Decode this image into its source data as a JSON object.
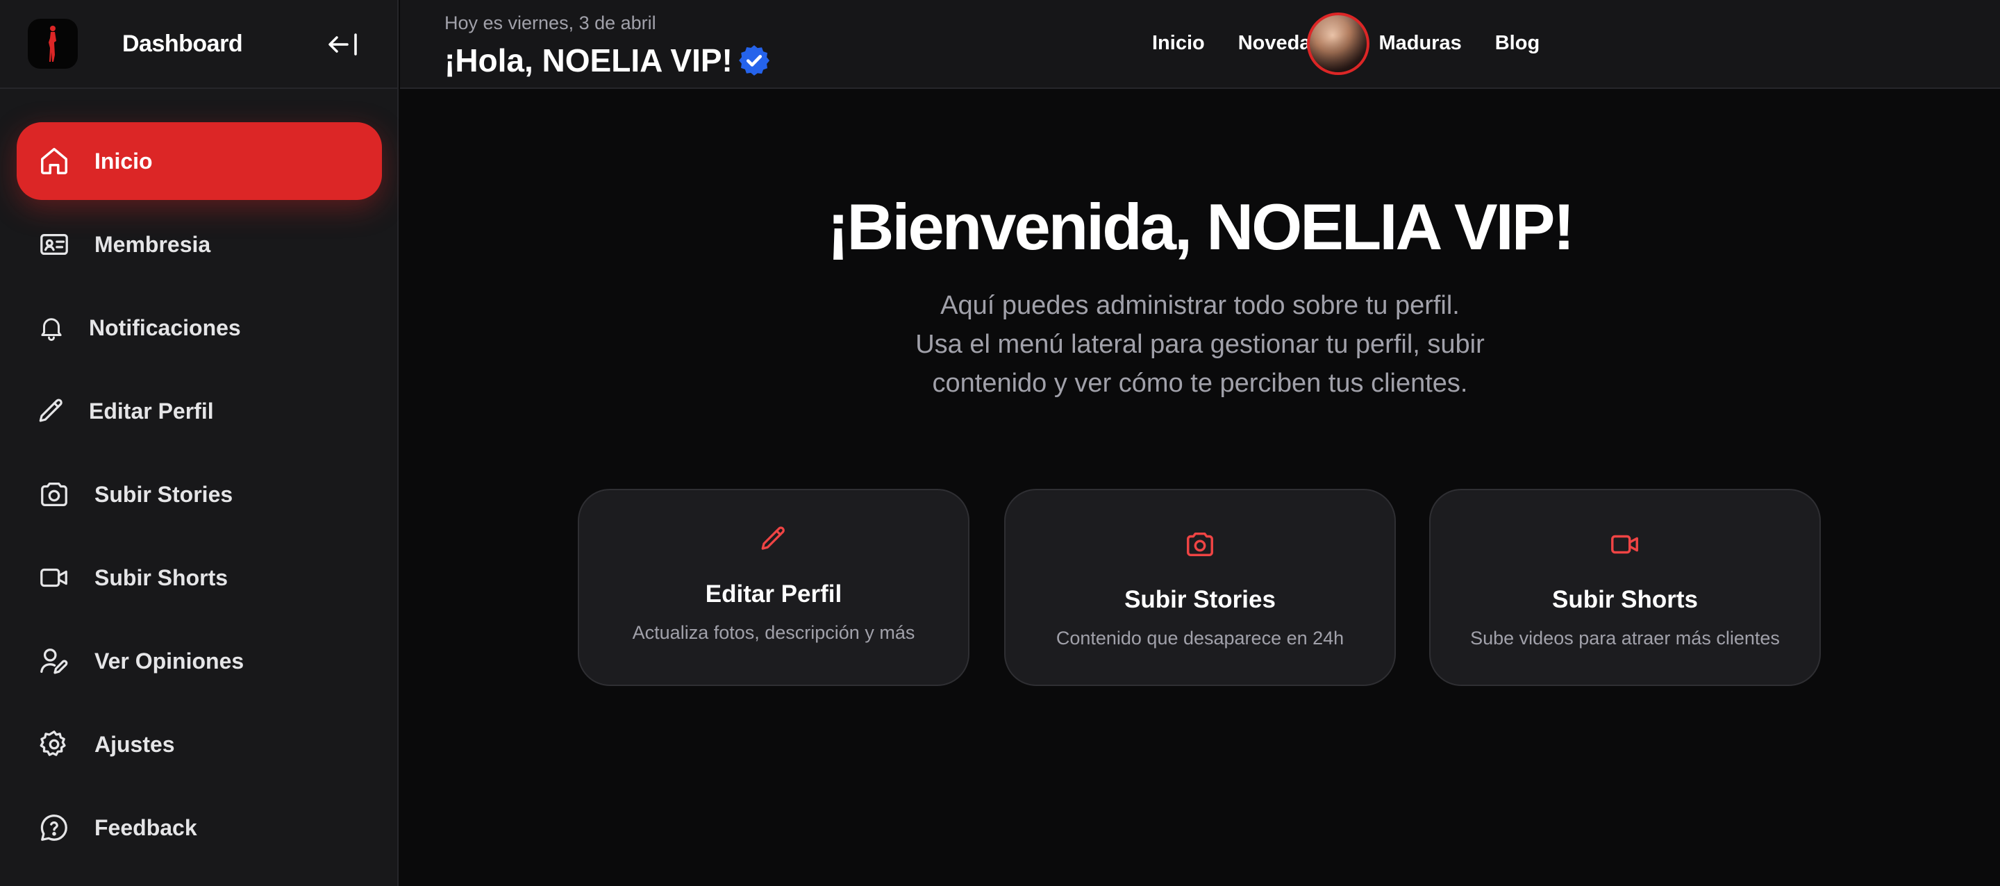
{
  "colors": {
    "accent": "#dc2626",
    "verified": "#2563eb",
    "background": "#0a0a0b",
    "sidebar": "#18181a"
  },
  "brand": {
    "title": "Dashboard",
    "logo_icon": "silhouette-logo-icon"
  },
  "sidebar": {
    "collapse_icon": "arrow-left-bar-icon",
    "items": [
      {
        "label": "Inicio",
        "icon": "home-icon",
        "active": true
      },
      {
        "label": "Membresia",
        "icon": "id-card-icon",
        "active": false
      },
      {
        "label": "Notificaciones",
        "icon": "bell-icon",
        "active": false
      },
      {
        "label": "Editar Perfil",
        "icon": "pencil-icon",
        "active": false
      },
      {
        "label": "Subir Stories",
        "icon": "camera-icon",
        "active": false
      },
      {
        "label": "Subir Shorts",
        "icon": "video-icon",
        "active": false
      },
      {
        "label": "Ver Opiniones",
        "icon": "user-edit-icon",
        "active": false
      },
      {
        "label": "Ajustes",
        "icon": "gear-icon",
        "active": false
      },
      {
        "label": "Feedback",
        "icon": "help-bubble-icon",
        "active": false
      }
    ]
  },
  "header": {
    "date_text": "Hoy es viernes, 3 de abril",
    "greeting": "¡Hola, NOELIA VIP!",
    "verified_icon": "verified-badge-icon",
    "nav": [
      {
        "label": "Inicio"
      },
      {
        "label": "Novedades"
      },
      {
        "label": "Maduras"
      },
      {
        "label": "Blog"
      }
    ],
    "avatar": "user-avatar"
  },
  "main": {
    "welcome": "¡Bienvenida, NOELIA VIP!",
    "subtitle_lines": [
      "Aquí puedes administrar todo sobre tu perfil.",
      "Usa el menú lateral para gestionar tu perfil, subir",
      "contenido y ver cómo te perciben tus clientes."
    ],
    "cards": [
      {
        "title": "Editar Perfil",
        "description": "Actualiza fotos, descripción y más",
        "icon": "pencil-icon"
      },
      {
        "title": "Subir Stories",
        "description": "Contenido que desaparece en 24h",
        "icon": "camera-icon"
      },
      {
        "title": "Subir Shorts",
        "description": "Sube videos para atraer más clientes",
        "icon": "video-icon"
      }
    ]
  }
}
